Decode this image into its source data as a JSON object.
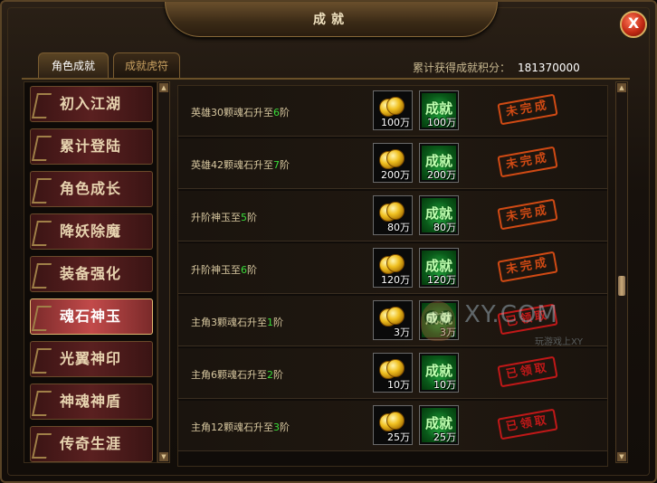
{
  "window": {
    "title": "成就",
    "close_label": "X"
  },
  "tabs": [
    {
      "label": "角色成就",
      "active": true
    },
    {
      "label": "成就虎符",
      "active": false
    }
  ],
  "score": {
    "label": "累计获得成就积分：",
    "value": "181370000"
  },
  "sidebar": {
    "items": [
      {
        "label": "初入江湖",
        "active": false
      },
      {
        "label": "累计登陆",
        "active": false
      },
      {
        "label": "角色成长",
        "active": false
      },
      {
        "label": "降妖除魔",
        "active": false
      },
      {
        "label": "装备强化",
        "active": false
      },
      {
        "label": "魂石神玉",
        "active": true
      },
      {
        "label": "光翼神印",
        "active": false
      },
      {
        "label": "神魂神盾",
        "active": false
      },
      {
        "label": "传奇生涯",
        "active": false
      }
    ]
  },
  "achievements": [
    {
      "pre": "英雄30颗魂石升至",
      "num": "6",
      "post": "阶",
      "gold": "100万",
      "points": "100万",
      "status": "未完成",
      "done": false
    },
    {
      "pre": "英雄42颗魂石升至",
      "num": "7",
      "post": "阶",
      "gold": "200万",
      "points": "200万",
      "status": "未完成",
      "done": false
    },
    {
      "pre": "升阶神玉至",
      "num": "5",
      "post": "阶",
      "gold": "80万",
      "points": "80万",
      "status": "未完成",
      "done": false
    },
    {
      "pre": "升阶神玉至",
      "num": "6",
      "post": "阶",
      "gold": "120万",
      "points": "120万",
      "status": "未完成",
      "done": false
    },
    {
      "pre": "主角3颗魂石升至",
      "num": "1",
      "post": "阶",
      "gold": "3万",
      "points": "3万",
      "status": "已领取",
      "done": true
    },
    {
      "pre": "主角6颗魂石升至",
      "num": "2",
      "post": "阶",
      "gold": "10万",
      "points": "10万",
      "status": "已领取",
      "done": true
    },
    {
      "pre": "主角12颗魂石升至",
      "num": "3",
      "post": "阶",
      "gold": "25万",
      "points": "25万",
      "status": "已领取",
      "done": true
    }
  ],
  "reward_badge_text": "成就",
  "watermark": {
    "brand": "XY.COM",
    "sub": "玩游戏上XY"
  }
}
